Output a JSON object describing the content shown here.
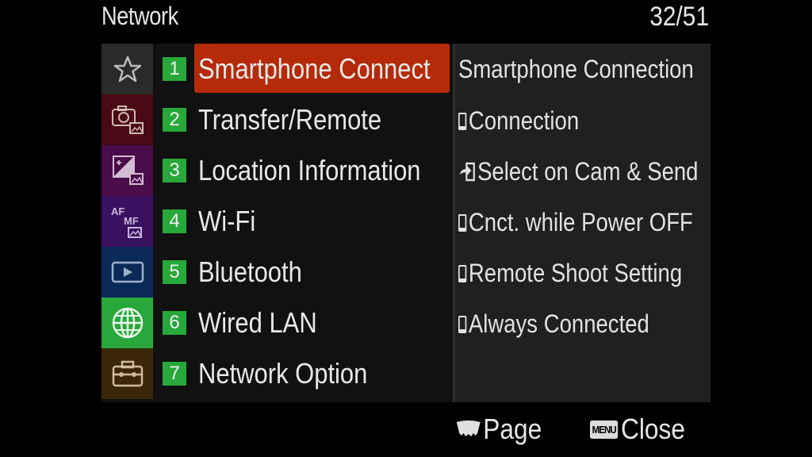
{
  "header": {
    "title": "Network",
    "page_indicator": "32/51"
  },
  "tabs": [
    {
      "name": "my-menu",
      "icon": "star-icon",
      "bg": "#2a2a2a",
      "selected": false
    },
    {
      "name": "shooting-photo",
      "icon": "camera-photo-icon",
      "bg": "#4a0a14",
      "selected": false
    },
    {
      "name": "exposure-color",
      "icon": "exposure-icon",
      "bg": "#4a0c4a",
      "selected": false
    },
    {
      "name": "focus",
      "icon": "af-mf-icon",
      "bg": "#3a1060",
      "selected": false
    },
    {
      "name": "playback",
      "icon": "playback-icon",
      "bg": "#0c2a58",
      "selected": false
    },
    {
      "name": "network",
      "icon": "globe-icon",
      "bg": "#28a83a",
      "selected": true
    },
    {
      "name": "setup",
      "icon": "toolbox-icon",
      "bg": "#3a2608",
      "selected": false
    }
  ],
  "tab_texts": {
    "af": "AF",
    "mf": "MF"
  },
  "menu": {
    "selected_index": 0,
    "items": [
      {
        "number": "1",
        "label": "Smartphone Connect"
      },
      {
        "number": "2",
        "label": "Transfer/Remote"
      },
      {
        "number": "3",
        "label": "Location Information"
      },
      {
        "number": "4",
        "label": "Wi-Fi"
      },
      {
        "number": "5",
        "label": "Bluetooth"
      },
      {
        "number": "6",
        "label": "Wired LAN"
      },
      {
        "number": "7",
        "label": "Network Option"
      }
    ]
  },
  "detail": {
    "heading": "Smartphone Connection",
    "items": [
      {
        "icon": "smartphone-icon",
        "label": "Connection"
      },
      {
        "icon": "send-to-phone-icon",
        "label": "Select on Cam & Send"
      },
      {
        "icon": "smartphone-icon",
        "label": "Cnct. while Power OFF"
      },
      {
        "icon": "smartphone-icon",
        "label": "Remote Shoot Setting"
      },
      {
        "icon": "smartphone-icon",
        "label": "Always Connected"
      }
    ]
  },
  "footer": {
    "page_label": "Page",
    "menu_key": "MENU",
    "close_label": "Close"
  },
  "colors": {
    "highlight": "#b52a08",
    "number_badge": "#28a83a"
  }
}
